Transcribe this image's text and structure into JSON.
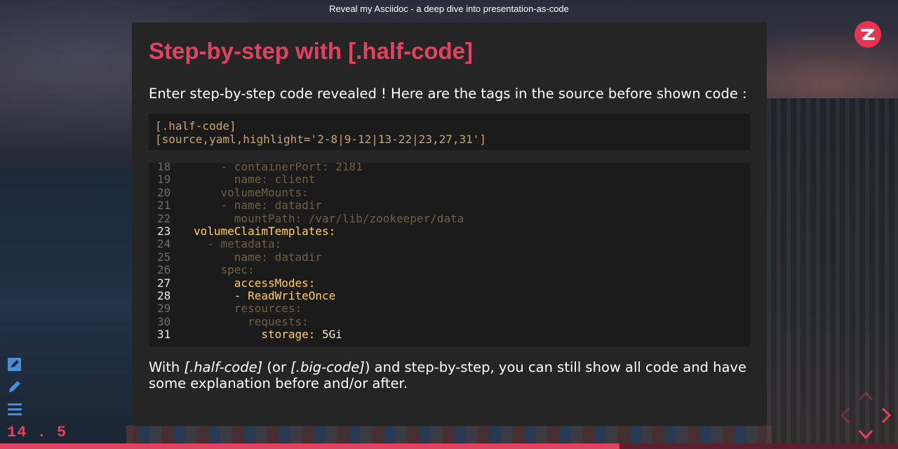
{
  "window": {
    "title": "Reveal my Asciidoc - a deep dive into presentation-as-code"
  },
  "colors": {
    "accent": "#e2415f",
    "code_highlight": "#ffcf5a",
    "code_dim": "#6e6043"
  },
  "slide": {
    "title": "Step-by-step with [.half-code]",
    "intro": "Enter step-by-step code revealed ! Here are the tags in the source before shown code :",
    "source_lines": [
      "[.half-code]",
      "[source,yaml,highlight='2-8|9-12|13-22|23,27,31']"
    ],
    "code_lines": [
      {
        "num": "18",
        "text": "    - containerPort: 2181",
        "highlight": false
      },
      {
        "num": "19",
        "text": "      name: client",
        "highlight": false
      },
      {
        "num": "20",
        "text": "    volumeMounts:",
        "highlight": false
      },
      {
        "num": "21",
        "text": "    - name: datadir",
        "highlight": false
      },
      {
        "num": "22",
        "text": "      mountPath: /var/lib/zookeeper/data",
        "highlight": false
      },
      {
        "num": "23",
        "text": "volumeClaimTemplates:",
        "highlight": true
      },
      {
        "num": "24",
        "text": "  - metadata:",
        "highlight": false
      },
      {
        "num": "25",
        "text": "      name: datadir",
        "highlight": false
      },
      {
        "num": "26",
        "text": "    spec:",
        "highlight": false
      },
      {
        "num": "27",
        "text": "      accessModes:",
        "highlight": true
      },
      {
        "num": "28",
        "text": "      - ReadWriteOnce",
        "highlight": true
      },
      {
        "num": "29",
        "text": "      resources:",
        "highlight": false
      },
      {
        "num": "30",
        "text": "        requests:",
        "highlight": false
      },
      {
        "num": "31",
        "text": "          storage:",
        "value": " 5Gi",
        "highlight": true
      }
    ],
    "outro": {
      "p1": "With ",
      "em1": "[.half-code]",
      "p2": " (or ",
      "em2": "[.big-code]",
      "p3": ") and step-by-step, you can still show all code and have some explanation before and/or after."
    }
  },
  "sidebar": {
    "tools": [
      {
        "name": "edit-icon"
      },
      {
        "name": "pencil-icon"
      },
      {
        "name": "menu-icon"
      }
    ]
  },
  "slide_number": "14 . 5",
  "progress": {
    "fraction": 0.69
  },
  "icons": {
    "logo": "zenika-logo",
    "nav": "navigation-arrows-icon"
  }
}
